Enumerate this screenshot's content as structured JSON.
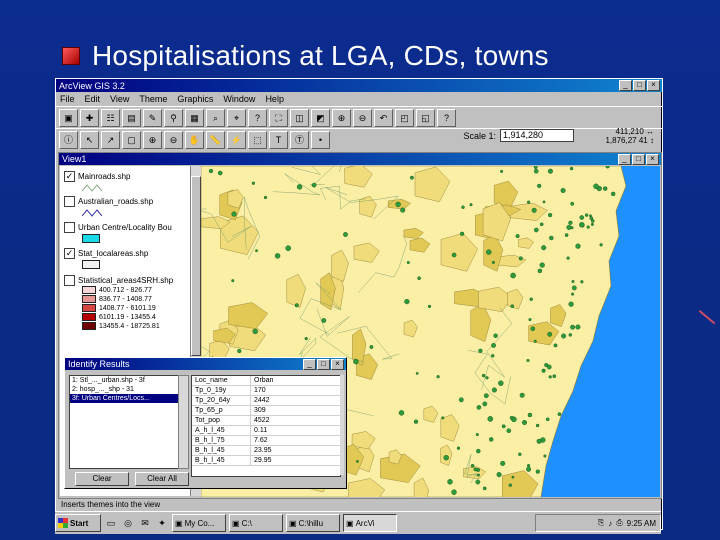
{
  "slide": {
    "title": "Hospitalisations at LGA, CDs, towns"
  },
  "app": {
    "title": "ArcView GIS 3.2",
    "menu": [
      "File",
      "Edit",
      "View",
      "Theme",
      "Graphics",
      "Window",
      "Help"
    ],
    "scale_label": "Scale 1:",
    "scale_value": "1,914,280",
    "coord_x": "411,210",
    "coord_y": "1,876,27",
    "coord_n": "41"
  },
  "view": {
    "title": "View1",
    "layers": [
      {
        "name": "Mainroads.shp",
        "checked": true
      },
      {
        "name": "Australian_roads.shp",
        "checked": false
      },
      {
        "name": "Urban Centre/Locality Bou",
        "checked": false
      },
      {
        "name": "Stat_localareas.shp",
        "checked": true
      },
      {
        "name": "Statistical_areas4SRH.shp",
        "checked": false
      }
    ],
    "legend": [
      {
        "label": "400.712 - 826.77",
        "color": "#f4d6d6"
      },
      {
        "label": "836.77 - 1408.77",
        "color": "#e79696"
      },
      {
        "label": "1408.77 - 6101.19",
        "color": "#d84545"
      },
      {
        "label": "6101.19 - 13455.4",
        "color": "#b40000"
      },
      {
        "label": "13455.4 - 18725.81",
        "color": "#6e0000"
      }
    ]
  },
  "identify": {
    "title": "Identify Results",
    "list": [
      {
        "text": "1: Stl_..._urban.shp - 3f",
        "selected": false
      },
      {
        "text": "2: hosp_..._shp - 31",
        "selected": false
      },
      {
        "text": "3f: Urban Centres/Locs...",
        "selected": true
      },
      {
        "text": "",
        "selected": false
      },
      {
        "text": "",
        "selected": false
      },
      {
        "text": "",
        "selected": false
      },
      {
        "text": "",
        "selected": false
      },
      {
        "text": "",
        "selected": false
      },
      {
        "text": "",
        "selected": false
      },
      {
        "text": "",
        "selected": false
      }
    ],
    "attributes": [
      {
        "k": "Loc_name",
        "v": "Orban"
      },
      {
        "k": "Tp_0_19y",
        "v": "170"
      },
      {
        "k": "Tp_20_64y",
        "v": "2442"
      },
      {
        "k": "Tp_65_p",
        "v": "309"
      },
      {
        "k": "Tot_pop",
        "v": "4522"
      },
      {
        "k": "A_h_l_45",
        "v": "0.11"
      },
      {
        "k": "B_h_l_75",
        "v": "7.62"
      },
      {
        "k": "B_h_l_45",
        "v": "23.95"
      },
      {
        "k": "B_h_l_45",
        "v": "29.95"
      }
    ],
    "clear_label": "Clear",
    "clear_all_label": "Clear All"
  },
  "status": "Inserts themes into the view",
  "taskbar": {
    "start": "Start",
    "tasks": [
      {
        "label": "My Co...",
        "active": false
      },
      {
        "label": "C:\\",
        "active": false
      },
      {
        "label": "C:\\hillu",
        "active": false
      },
      {
        "label": "ArcVi",
        "active": true
      }
    ],
    "time": "9:25 AM"
  },
  "colors": {
    "slide_bg": "#0b2c8f",
    "titlebar": "#000080",
    "map_water": "#1e90ff",
    "map_land_light": "#fbeea5",
    "map_land_dark": "#d9c146",
    "town_dot": "#2e9a3a"
  }
}
